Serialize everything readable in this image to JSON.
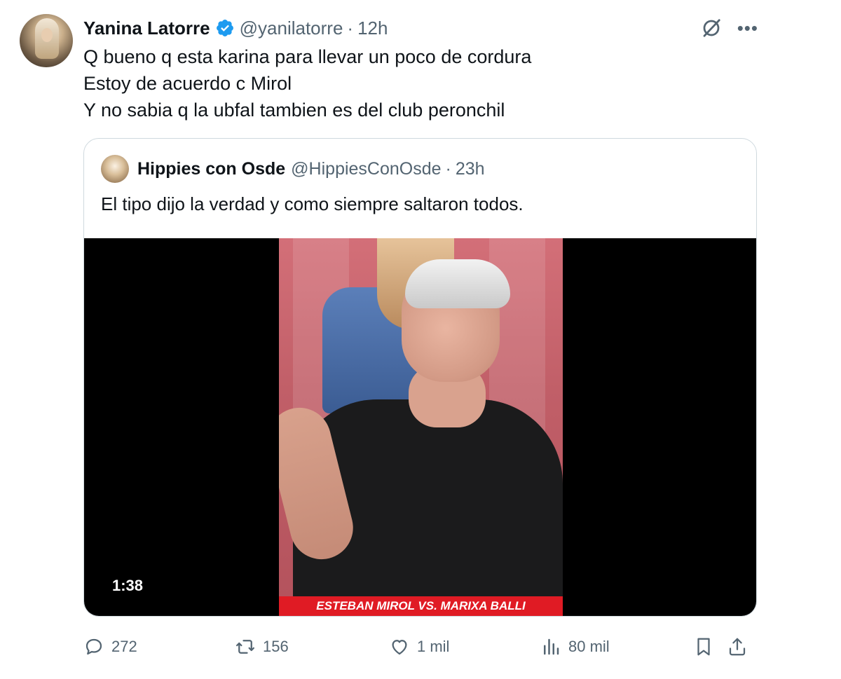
{
  "tweet": {
    "author_name": "Yanina Latorre",
    "handle": "@yanilatorre",
    "separator": "·",
    "time": "12h",
    "lines": [
      "Q bueno q esta karina para llevar un poco de cordura",
      "Estoy de acuerdo c Mirol",
      "Y no sabia q la ubfal tambien es del club peronchil"
    ]
  },
  "quote": {
    "author_name": "Hippies con Osde",
    "handle": "@HippiesConOsde",
    "separator": "·",
    "time": "23h",
    "text": "El tipo dijo la verdad y como siempre saltaron todos."
  },
  "video": {
    "duration": "1:38",
    "banner": "ESTEBAN MIROL VS. MARIXA BALLI"
  },
  "actions": {
    "replies": "272",
    "reposts": "156",
    "likes": "1 mil",
    "views": "80 mil"
  },
  "icons": {
    "verified": "verified-badge-icon",
    "grok": "grok-icon",
    "more": "more-icon",
    "reply": "reply-icon",
    "repost": "repost-icon",
    "like": "like-icon",
    "views": "views-icon",
    "bookmark": "bookmark-icon",
    "share": "share-icon"
  },
  "colors": {
    "accent": "#1d9bf0",
    "secondary_text": "#536471",
    "border": "#cfd9de",
    "banner": "#e01b24"
  }
}
